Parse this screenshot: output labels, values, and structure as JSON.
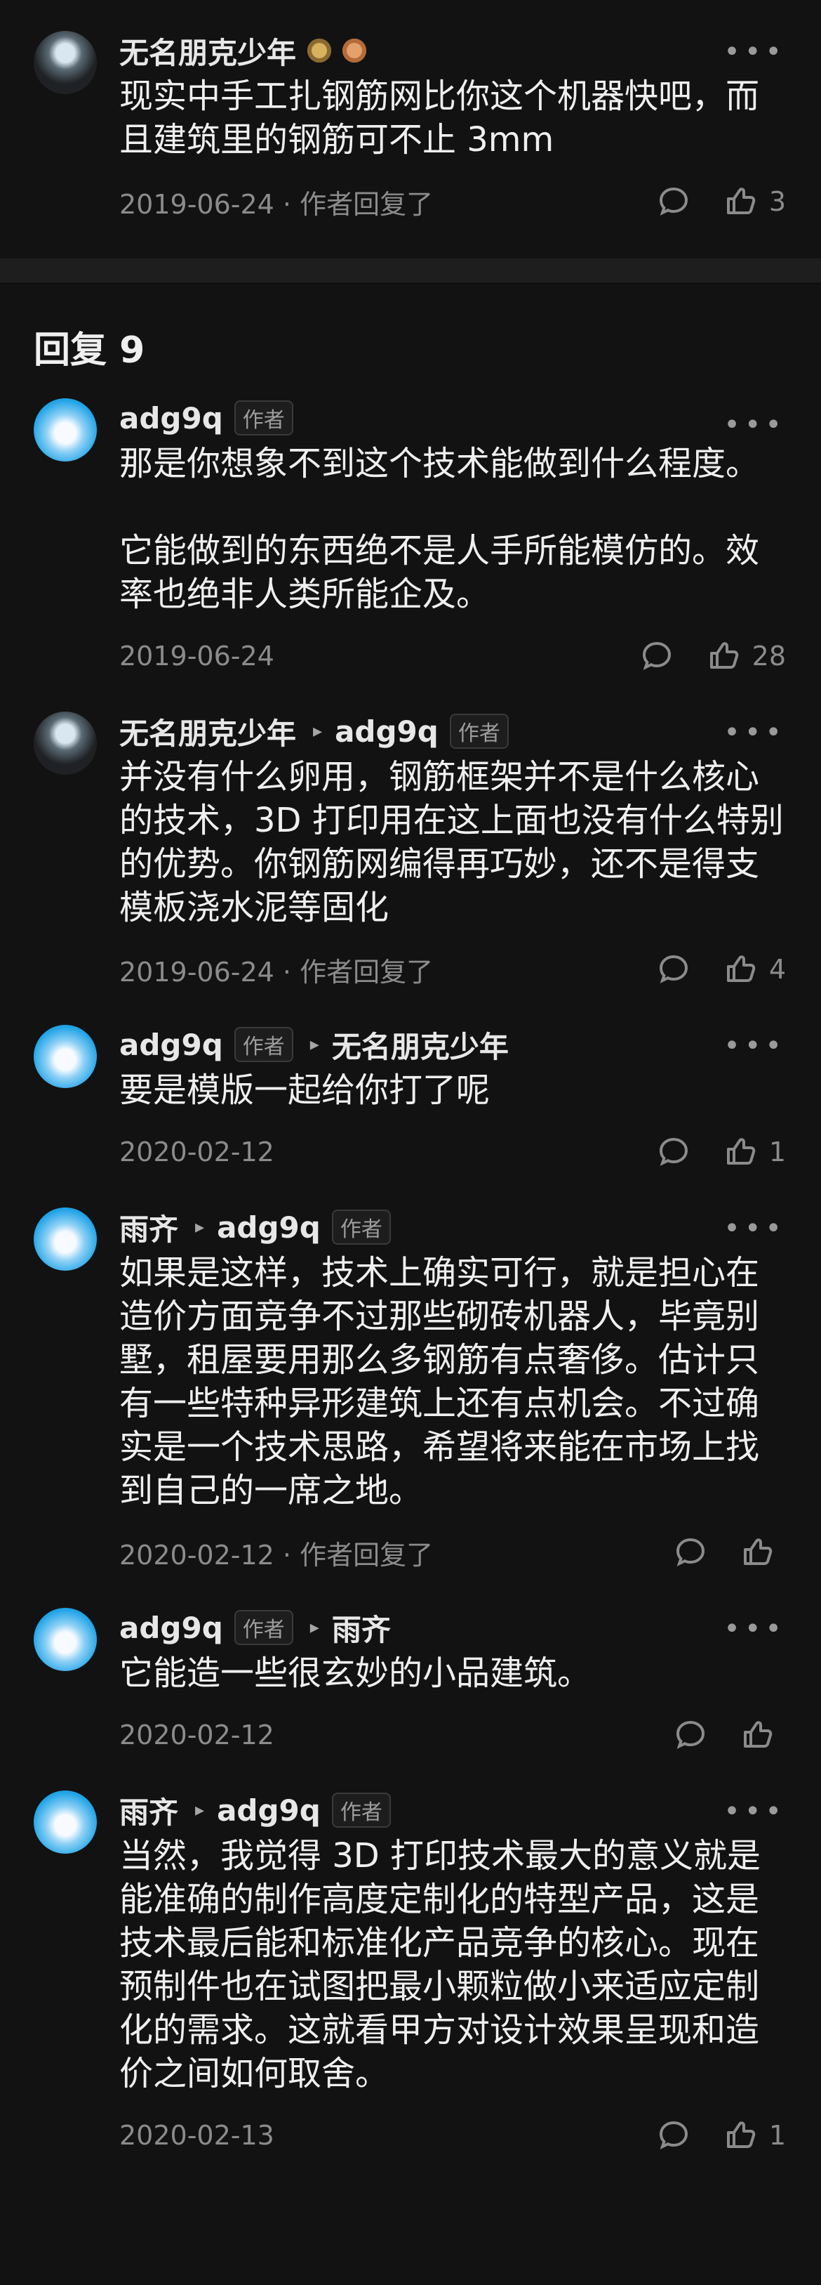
{
  "top_comment": {
    "author": "无名朋克少年",
    "text": "现实中手工扎钢筋网比你这个机器快吧，而且建筑里的钢筋可不止 3mm",
    "date": "2019-06-24 · 作者回复了",
    "likes": "3"
  },
  "replies_header": "回复 9",
  "badge_author": "作者",
  "replies": [
    {
      "author": "adg9q",
      "author_badge": "作者",
      "to": "",
      "to_badge": "",
      "text": "那是你想象不到这个技术能做到什么程度。\n\n它能做到的东西绝不是人手所能模仿的。效率也绝非人类所能企及。",
      "date": "2019-06-24",
      "likes": "28",
      "avatar": "bear"
    },
    {
      "author": "无名朋克少年",
      "author_badge": "",
      "to": "adg9q",
      "to_badge": "作者",
      "text": "并没有什么卵用，钢筋框架并不是什么核心的技术，3D 打印用在这上面也没有什么特别的优势。你钢筋网编得再巧妙，还不是得支模板浇水泥等固化",
      "date": "2019-06-24 · 作者回复了",
      "likes": "4",
      "avatar": "punk"
    },
    {
      "author": "adg9q",
      "author_badge": "作者",
      "to": "无名朋克少年",
      "to_badge": "",
      "text": "要是模版一起给你打了呢",
      "date": "2020-02-12",
      "likes": "1",
      "avatar": "bear"
    },
    {
      "author": "雨齐",
      "author_badge": "",
      "to": "adg9q",
      "to_badge": "作者",
      "text": "如果是这样，技术上确实可行，就是担心在造价方面竞争不过那些砌砖机器人，毕竟别墅，租屋要用那么多钢筋有点奢侈。估计只有一些特种异形建筑上还有点机会。不过确实是一个技术思路，希望将来能在市场上找到自己的一席之地。",
      "date": "2020-02-12 · 作者回复了",
      "likes": "",
      "avatar": "bear"
    },
    {
      "author": "adg9q",
      "author_badge": "作者",
      "to": "雨齐",
      "to_badge": "",
      "text": "它能造一些很玄妙的小品建筑。",
      "date": "2020-02-12",
      "likes": "",
      "avatar": "bear"
    },
    {
      "author": "雨齐",
      "author_badge": "",
      "to": "adg9q",
      "to_badge": "作者",
      "text": "当然，我觉得 3D 打印技术最大的意义就是能准确的制作高度定制化的特型产品，这是技术最后能和标准化产品竞争的核心。现在预制件也在试图把最小颗粒做小来适应定制化的需求。这就看甲方对设计效果呈现和造价之间如何取舍。",
      "date": "2020-02-13",
      "likes": "1",
      "avatar": "bear"
    }
  ]
}
